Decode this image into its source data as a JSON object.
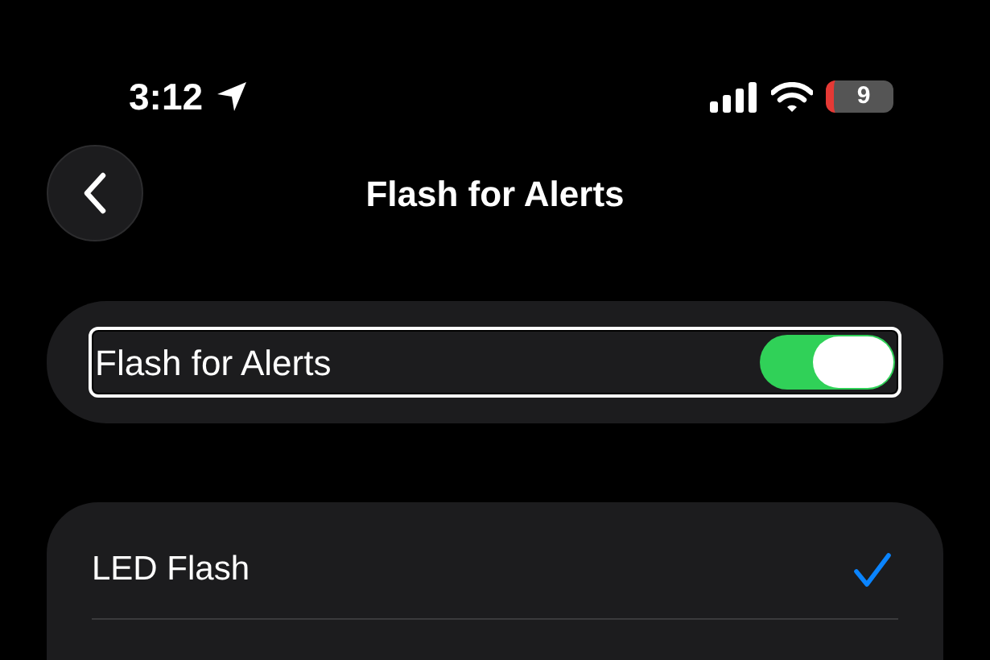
{
  "status_bar": {
    "time": "3:12",
    "battery": "9"
  },
  "nav": {
    "title": "Flash for Alerts"
  },
  "toggle_row": {
    "label": "Flash for Alerts",
    "on": true,
    "focused": true
  },
  "options": [
    {
      "label": "LED Flash",
      "selected": true
    }
  ]
}
